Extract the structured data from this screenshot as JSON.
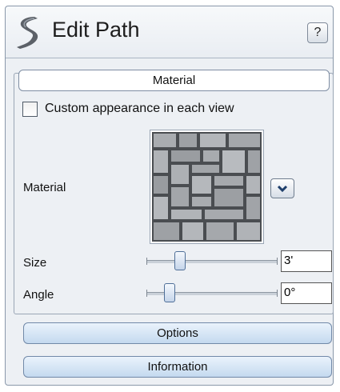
{
  "header": {
    "title": "Edit Path",
    "help_label": "?"
  },
  "material_group": {
    "title": "Material",
    "custom_appearance_label": "Custom appearance in each view",
    "custom_appearance_checked": false,
    "material_label": "Material",
    "swatch_texture": "gray-stone-pavers"
  },
  "size": {
    "label": "Size",
    "value": "3'",
    "slider_level": 0.26
  },
  "angle": {
    "label": "Angle",
    "value": "0°",
    "slider_level": 0.18
  },
  "buttons": {
    "options": "Options",
    "information": "Information"
  },
  "icons": {
    "logo": "path-logo-icon",
    "dropdown": "chevron-down-icon"
  },
  "colors": {
    "panel_bg": "#edf0f4",
    "accent_button": "#c4d9ef",
    "logo": "#5c6168"
  }
}
